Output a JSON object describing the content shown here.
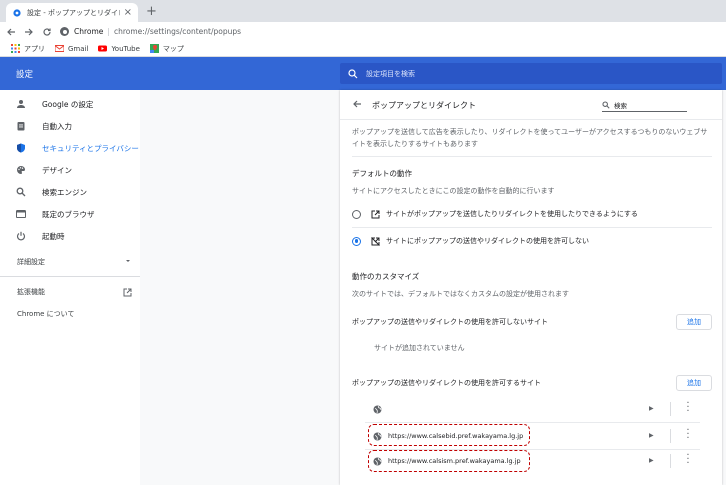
{
  "browser": {
    "tab_title": "設定 - ポップアップとリダイレクト",
    "tab_close": "×",
    "new_tab": "+",
    "omnibox_chrome": "Chrome",
    "omnibox_sep": "|",
    "url": "chrome://settings/content/popups",
    "bookmarks": [
      "アプリ",
      "Gmail",
      "YouTube",
      "マップ"
    ]
  },
  "settings": {
    "title": "設定",
    "search_placeholder": "設定項目を検索"
  },
  "sidebar": {
    "items": [
      {
        "label": "Google の設定",
        "icon": "person-icon"
      },
      {
        "label": "自動入力",
        "icon": "clipboard-icon"
      },
      {
        "label": "セキュリティとプライバシー",
        "icon": "shield-icon",
        "active": true
      },
      {
        "label": "デザイン",
        "icon": "palette-icon"
      },
      {
        "label": "検索エンジン",
        "icon": "search-icon"
      },
      {
        "label": "既定のブラウザ",
        "icon": "browser-icon"
      },
      {
        "label": "起動時",
        "icon": "power-icon"
      }
    ],
    "advanced": "詳細設定",
    "extensions": "拡張機能",
    "about": "Chrome について"
  },
  "popups": {
    "title": "ポップアップとリダイレクト",
    "search_label": "検索",
    "description": "ポップアップを送信して広告を表示したり、リダイレクトを使ってユーザーがアクセスするつもりのないウェブサイトを表示したりするサイトもあります",
    "default_heading": "デフォルトの動作",
    "default_sub": "サイトにアクセスしたときにこの設定の動作を自動的に行います",
    "option_allow": "サイトがポップアップを送信したりリダイレクトを使用したりできるようにする",
    "option_block": "サイトにポップアップの送信やリダイレクトの使用を許可しない",
    "custom_heading": "動作のカスタマイズ",
    "custom_sub": "次のサイトでは、デフォルトではなくカスタムの設定が使用されます",
    "block_list_label": "ポップアップの送信やリダイレクトの使用を許可しないサイト",
    "add_label": "追加",
    "no_sites": "サイトが追加されていません",
    "allow_list_label": "ポップアップの送信やリダイレクトの使用を許可するサイト",
    "allowed_sites": [
      "",
      "https://www.calsebid.pref.wakayama.lg.jp",
      "https://www.calsism.pref.wakayama.lg.jp"
    ]
  },
  "colors": {
    "header_blue": "#3367d6",
    "accent": "#1a73e8",
    "highlight_red": "#c00000"
  }
}
